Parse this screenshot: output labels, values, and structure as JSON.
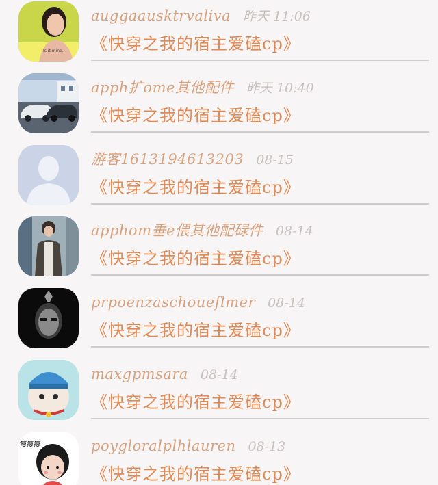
{
  "items": [
    {
      "username": "auggaausktrvaliva",
      "time": "昨天 11:06",
      "title": "《快穿之我的宿主爱磕cp》",
      "avatar_icon": "woman-portrait",
      "avatar_caption": "Is it mine."
    },
    {
      "username": "apph扩ome其他配件",
      "time": "昨天 10:40",
      "title": "《快穿之我的宿主爱磕cp》",
      "avatar_icon": "cars-street"
    },
    {
      "username": "游客1613194613203",
      "time": "08-15",
      "title": "《快穿之我的宿主爱磕cp》",
      "avatar_icon": "default-user"
    },
    {
      "username": "apphom垂e偎其他配碌件",
      "time": "08-14",
      "title": "《快穿之我的宿主爱磕cp》",
      "avatar_icon": "man-standing"
    },
    {
      "username": "prpoenzaschoueflmer",
      "time": "08-14",
      "title": "《快穿之我的宿主爱磕cp》",
      "avatar_icon": "dark-masked-face"
    },
    {
      "username": "maxgpmsara",
      "time": "08-14",
      "title": "《快穿之我的宿主爱磕cp》",
      "avatar_icon": "cat-blue-hat"
    },
    {
      "username": "poygloralplhlauren",
      "time": "08-13",
      "title": "《快穿之我的宿主爱磕cp》",
      "avatar_icon": "cartoon-girl",
      "avatar_caption": "瘦瘦瘦"
    }
  ]
}
